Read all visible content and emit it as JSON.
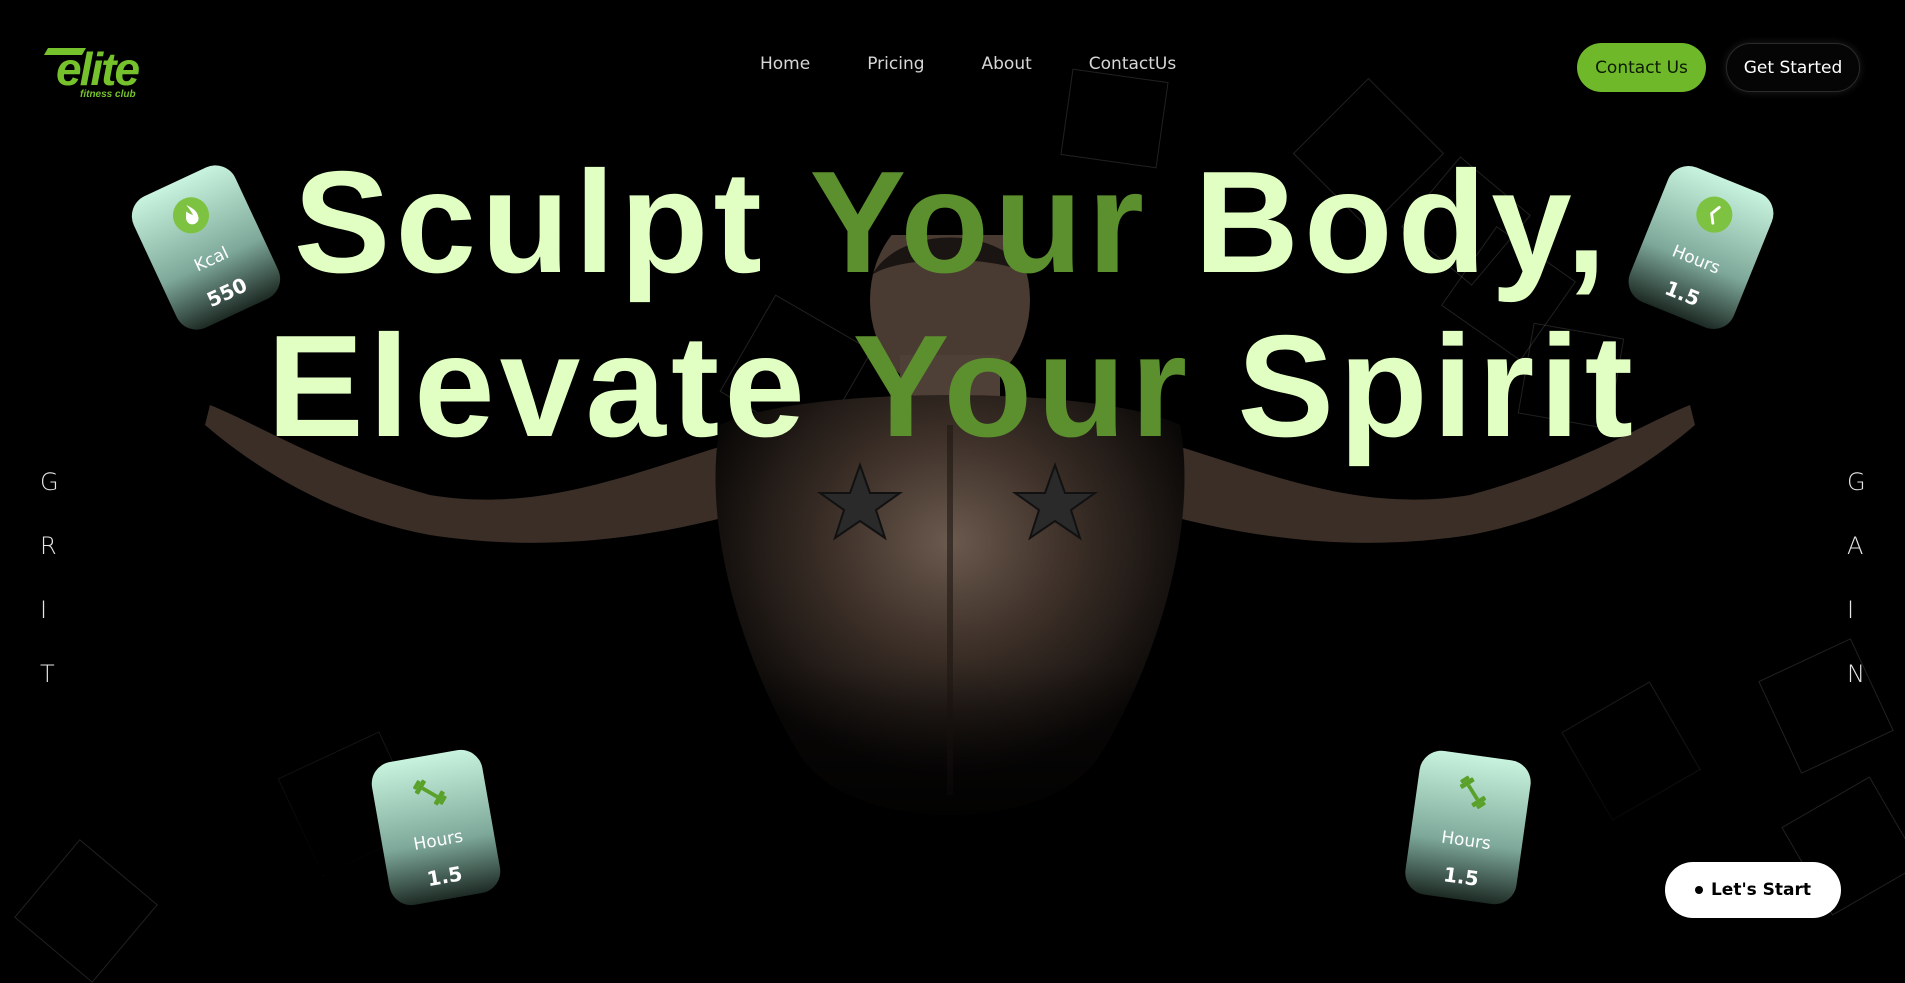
{
  "brand": {
    "name": "elite",
    "tagline": "fitness club",
    "accent_color": "#76c22c"
  },
  "nav": {
    "items": [
      {
        "label": "Home"
      },
      {
        "label": "Pricing"
      },
      {
        "label": "About"
      },
      {
        "label": "ContactUs"
      }
    ]
  },
  "header": {
    "contact_label": "Contact Us",
    "started_label": "Get Started"
  },
  "hero": {
    "line1_a": "Sculpt ",
    "line1_accent": "Your",
    "line1_b": " Body,",
    "line2_a": "Elevate ",
    "line2_accent": "Your",
    "line2_b": " Spirit"
  },
  "side_left": [
    "G",
    "R",
    "I",
    "T"
  ],
  "side_right": [
    "G",
    "A",
    "I",
    "N"
  ],
  "cards": [
    {
      "icon": "flame-icon",
      "label": "Kcal",
      "value": "550"
    },
    {
      "icon": "clock-icon",
      "label": "Hours",
      "value": "1.5"
    },
    {
      "icon": "dumbbell-icon",
      "label": "Hours",
      "value": "1.5"
    },
    {
      "icon": "dumbbell-icon",
      "label": "Hours",
      "value": "1.5"
    }
  ],
  "cta": {
    "label": "Let's Start"
  }
}
